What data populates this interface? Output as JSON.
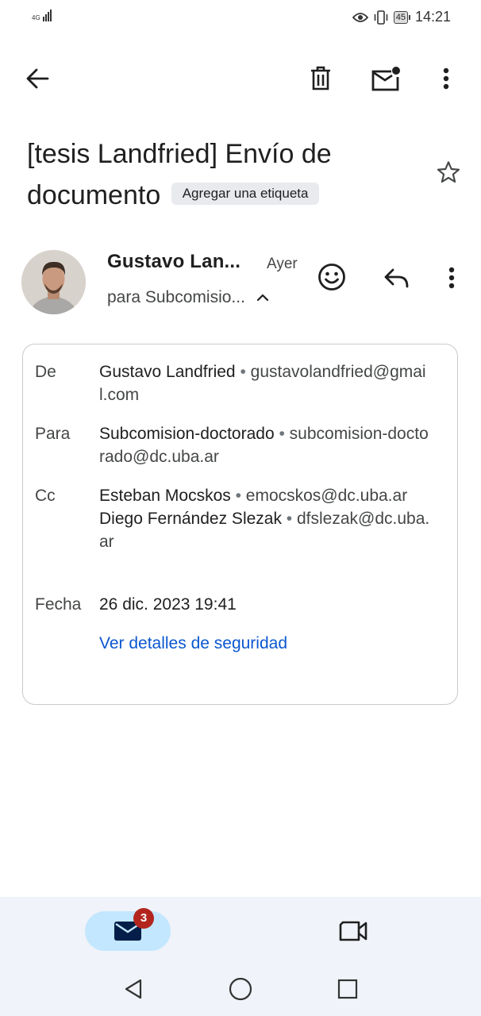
{
  "status_bar": {
    "network": "4G",
    "battery": "45",
    "time": "14:21"
  },
  "toolbar": {
    "back_icon": "arrow-back-icon",
    "delete_icon": "trash-icon",
    "mark_unread_icon": "mail-unread-icon",
    "more_icon": "more-vert-icon"
  },
  "email": {
    "subject": "[tesis Landfried] Envío de documento",
    "label_chip": "Agregar una etiqueta",
    "sender_name_short": "Gustavo Lan...",
    "time": "Ayer",
    "to_summary": "para Subcomisio...",
    "details": {
      "from_label": "De",
      "from_name": "Gustavo Landfried",
      "from_email": "gustavolandfried@gmail.com",
      "to_label": "Para",
      "to_name": "Subcomision-doctorado",
      "to_email": "subcomision-doctorado@dc.uba.ar",
      "cc_label": "Cc",
      "cc1_name": "Esteban Mocskos",
      "cc1_email": "emocskos@dc.uba.ar",
      "cc2_name": "Diego Fernández Slezak",
      "cc2_email": "dfslezak@dc.uba.ar",
      "date_label": "Fecha",
      "date_value": "26 dic. 2023 19:41",
      "security_link": "Ver detalles de seguridad"
    }
  },
  "bottom_nav": {
    "mail_badge": "3",
    "mail_icon": "mail-icon",
    "meet_icon": "video-camera-icon"
  },
  "system_nav": {
    "back_icon": "triangle-back-icon",
    "home_icon": "circle-home-icon",
    "recents_icon": "square-recents-icon"
  },
  "colors": {
    "link": "#0b57d0",
    "badge": "#b3261e",
    "nav_pill": "#c2e7ff",
    "bottom_bar": "#f0f3f9"
  }
}
